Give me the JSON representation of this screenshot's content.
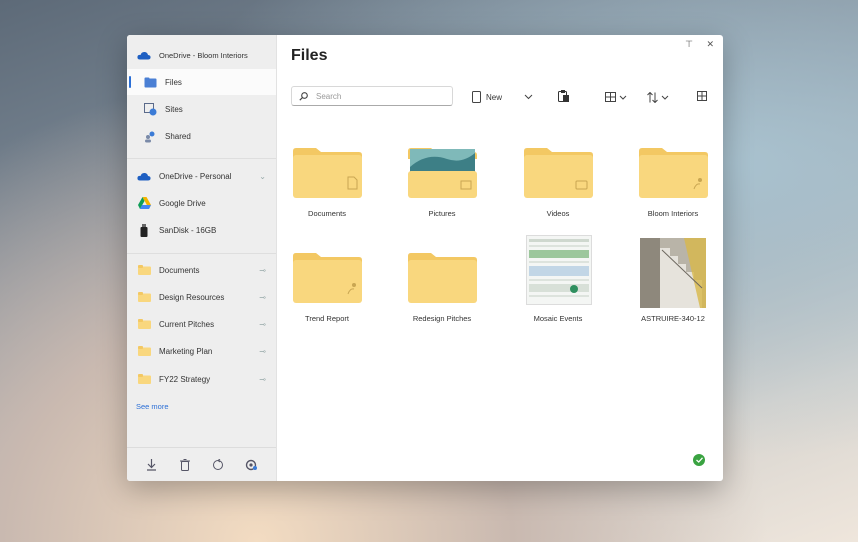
{
  "sidebar": {
    "account": "OneDrive - Bloom Interiors",
    "nav": [
      {
        "label": "Files",
        "icon": "files-icon"
      },
      {
        "label": "Sites",
        "icon": "sites-icon"
      },
      {
        "label": "Shared",
        "icon": "shared-icon"
      }
    ],
    "locations": [
      {
        "label": "OneDrive - Personal",
        "icon": "onedrive-icon"
      },
      {
        "label": "Google Drive",
        "icon": "google-drive-icon"
      },
      {
        "label": "SanDisk - 16GB",
        "icon": "usb-drive-icon"
      }
    ],
    "pinned": [
      {
        "label": "Documents"
      },
      {
        "label": "Design Resources"
      },
      {
        "label": "Current Pitches"
      },
      {
        "label": "Marketing Plan"
      },
      {
        "label": "FY22 Strategy"
      }
    ],
    "see_more": "See more"
  },
  "main": {
    "title": "Files",
    "search_placeholder": "Search",
    "new_label": "New",
    "items": [
      {
        "label": "Documents",
        "type": "folder",
        "badge": "document-icon"
      },
      {
        "label": "Pictures",
        "type": "folder-image",
        "badge": "image-icon"
      },
      {
        "label": "Videos",
        "type": "folder",
        "badge": "video-icon"
      },
      {
        "label": "Bloom Interiors",
        "type": "folder",
        "badge": "shared-icon"
      },
      {
        "label": "Trend Report",
        "type": "folder",
        "badge": "shared-icon"
      },
      {
        "label": "Redesign Pitches",
        "type": "folder",
        "badge": ""
      },
      {
        "label": "Mosaic Events",
        "type": "file-spreadsheet",
        "badge": ""
      },
      {
        "label": "ASTRUIRE-340-12",
        "type": "file-photo",
        "badge": ""
      }
    ]
  },
  "colors": {
    "accent": "#2b6fd6",
    "folder": "#f9d77e",
    "folder_tab": "#f3c863",
    "sync_ok": "#3aa341"
  }
}
